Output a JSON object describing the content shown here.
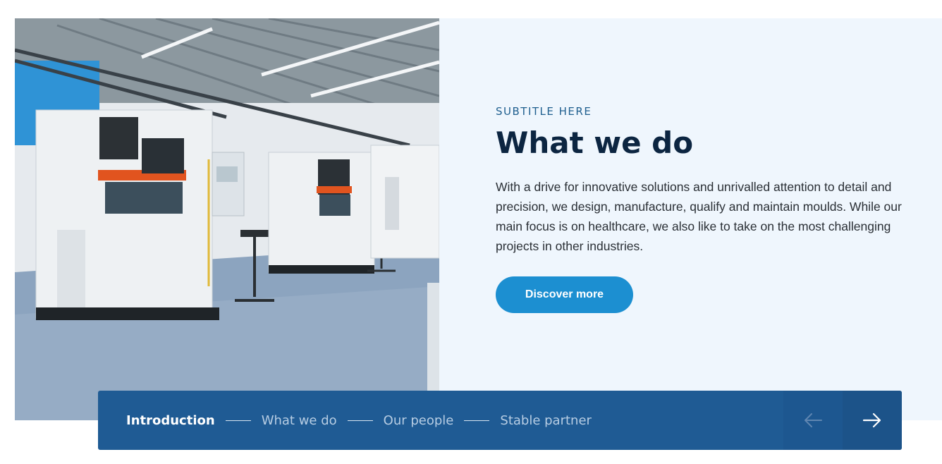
{
  "hero": {
    "photo_alt": "Factory floor with mould-making machines",
    "subtitle": "SUBTITLE HERE",
    "title": "What we do",
    "description": "With a drive for innovative solutions and unrivalled attention to detail and precision, we design, manufacture, qualify and maintain moulds. While our main focus is on healthcare, we also like to take on the most challenging projects in other industries.",
    "cta_label": "Discover more"
  },
  "carousel_nav": {
    "steps": [
      {
        "label": "Introduction",
        "active": true
      },
      {
        "label": "What we do",
        "active": false
      },
      {
        "label": "Our people",
        "active": false
      },
      {
        "label": "Stable partner",
        "active": false
      }
    ],
    "prev_icon": "arrow-left-icon",
    "next_icon": "arrow-right-icon"
  },
  "colors": {
    "accent": "#1c8fd1",
    "nav_background": "#1f5b94",
    "panel_background": "#eff6fd",
    "headline": "#0c2541"
  }
}
